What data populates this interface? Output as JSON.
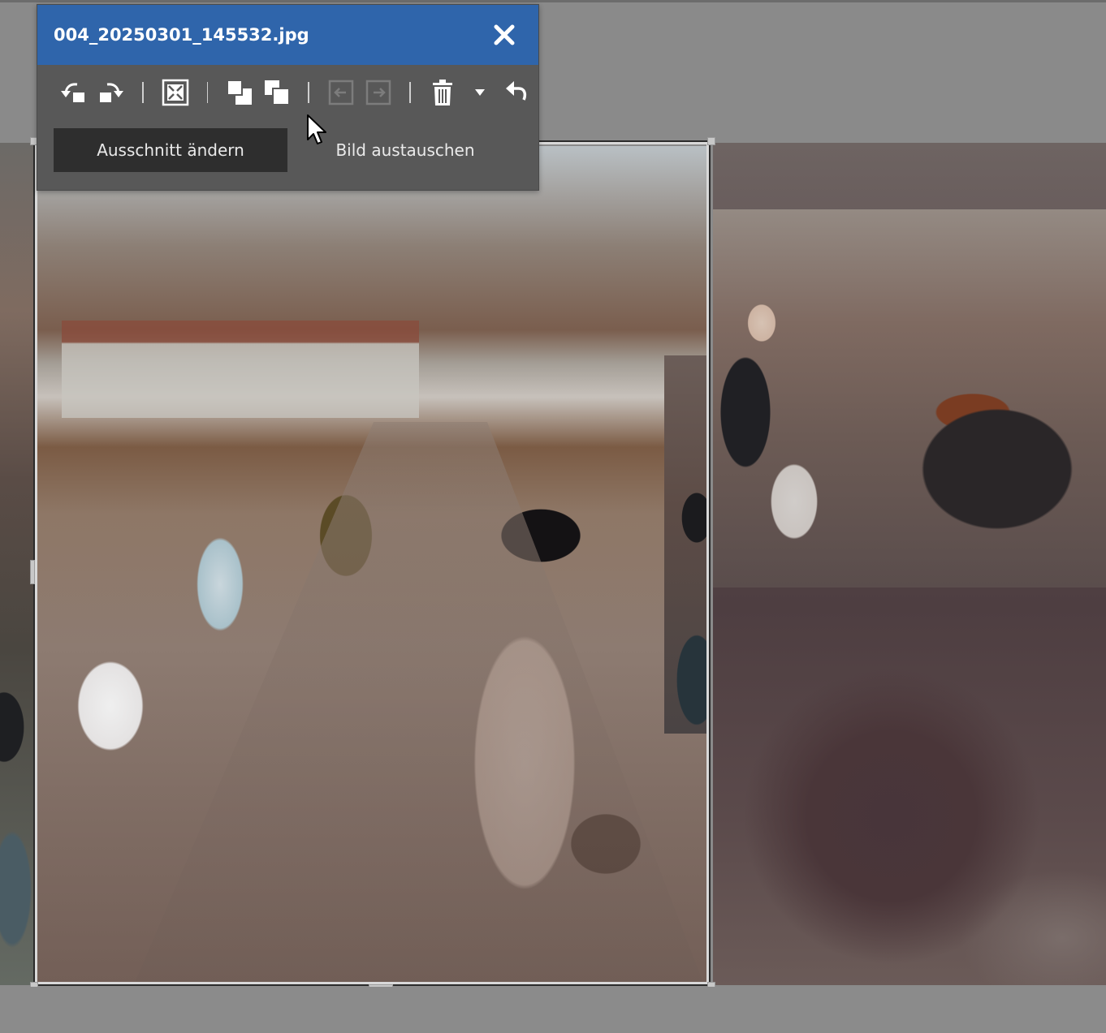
{
  "dialog": {
    "filename": "004_20250301_145532.jpg",
    "close_icon": "close-icon",
    "toolbar": [
      {
        "icon": "rotate-left-icon",
        "enabled": true
      },
      {
        "icon": "rotate-right-icon",
        "enabled": true
      },
      {
        "icon": "fit-fill-icon",
        "enabled": true
      },
      {
        "icon": "bring-forward-icon",
        "enabled": true
      },
      {
        "icon": "send-backward-icon",
        "enabled": true
      },
      {
        "icon": "move-left-icon",
        "enabled": false
      },
      {
        "icon": "move-right-icon",
        "enabled": false
      },
      {
        "icon": "delete-icon",
        "enabled": true
      },
      {
        "icon": "dropdown-arrow-icon",
        "enabled": true
      },
      {
        "icon": "undo-icon",
        "enabled": true
      }
    ],
    "crop_button_label": "Ausschnitt ändern",
    "replace_button_label": "Bild austauschen"
  },
  "colors": {
    "title_bar": "#2f65ab",
    "panel_bg": "#585858",
    "active_button_bg": "#2e2e2e",
    "canvas_bg": "#8a8a8a"
  }
}
